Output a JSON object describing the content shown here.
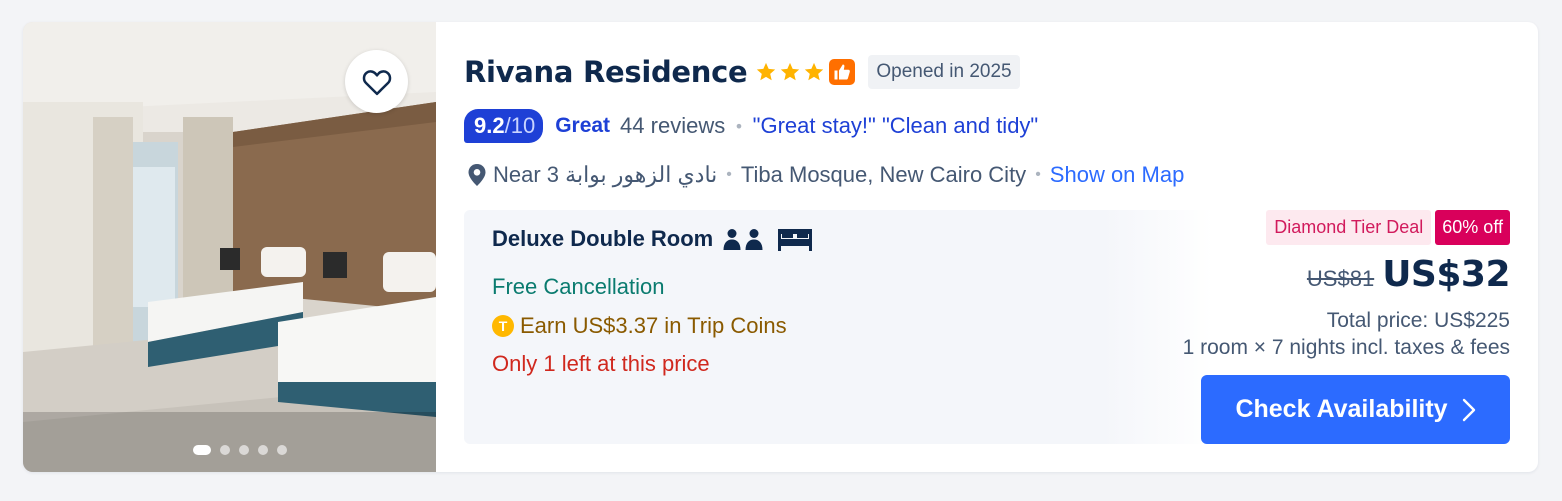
{
  "hotel": {
    "name": "Rivana Residence",
    "star_count": 3,
    "opened_badge": "Opened in 2025"
  },
  "rating": {
    "score": "9.2",
    "out_of": "/10",
    "word": "Great",
    "reviews": "44 reviews",
    "quotes": "\"Great stay!\" \"Clean and tidy\""
  },
  "location": {
    "near": "Near 3 نادي الزهور بوابة",
    "area": "Tiba Mosque, New Cairo City",
    "show_map": "Show on Map"
  },
  "room": {
    "name": "Deluxe Double Room",
    "free_cancellation": "Free Cancellation",
    "coins_icon": "T",
    "coins": "Earn US$3.37 in Trip Coins",
    "scarcity": "Only 1 left at this price"
  },
  "price": {
    "deal_tag": "Diamond Tier Deal",
    "discount": "60% off",
    "original": "US$81",
    "current": "US$32",
    "total": "Total price: US$225",
    "nights": "1 room × 7 nights incl. taxes & fees",
    "cta": "Check Availability"
  },
  "gallery": {
    "image_count": 5,
    "active_index": 0
  },
  "colors": {
    "accent": "#2c6bff",
    "rating": "#1e40d6",
    "deal": "#d9005b",
    "star": "#ffb300",
    "free_cancellation": "#0a7b6f",
    "coins": "#8a5a00",
    "scarcity": "#d0281e"
  },
  "icons": {
    "favorite": "heart-outline-icon",
    "badge": "thumbs-up-icon",
    "location": "map-pin-icon",
    "guests": "person-icon",
    "bed": "bed-icon",
    "cta": "chevron-right-icon"
  }
}
